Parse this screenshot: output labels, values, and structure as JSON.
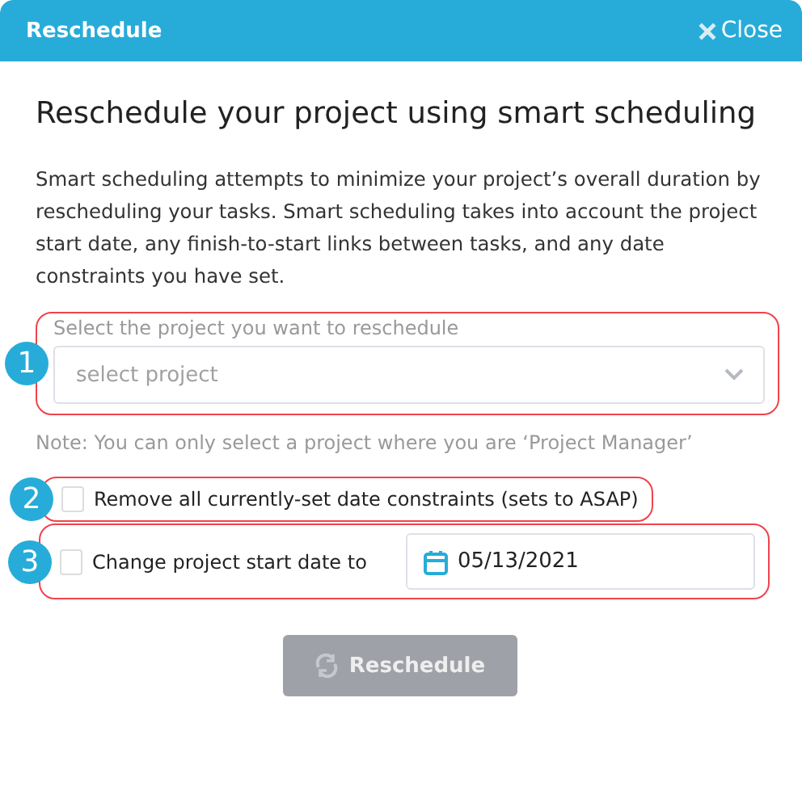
{
  "dialog": {
    "title": "Reschedule",
    "close_label": "Close"
  },
  "heading": "Reschedule your project using smart scheduling",
  "description": "Smart scheduling attempts to minimize your project’s overall duration by rescheduling your tasks. Smart scheduling takes into account the project start date, any finish-to-start links between tasks, and any date constraints you have set.",
  "project_select": {
    "badge": "1",
    "label": "Select the project you want to reschedule",
    "placeholder": "select project"
  },
  "note": "Note: You can only select a project where you are ‘Project Manager’",
  "options": [
    {
      "kind": "checkbox",
      "badge": "2",
      "label": "Remove all currently-set date constraints (sets to ASAP)",
      "checked": false
    },
    {
      "kind": "date",
      "badge": "3",
      "label": "Change project start date to",
      "checked": false,
      "value": "05/13/2021"
    }
  ],
  "button": {
    "label": "Reschedule",
    "disabled": true
  }
}
